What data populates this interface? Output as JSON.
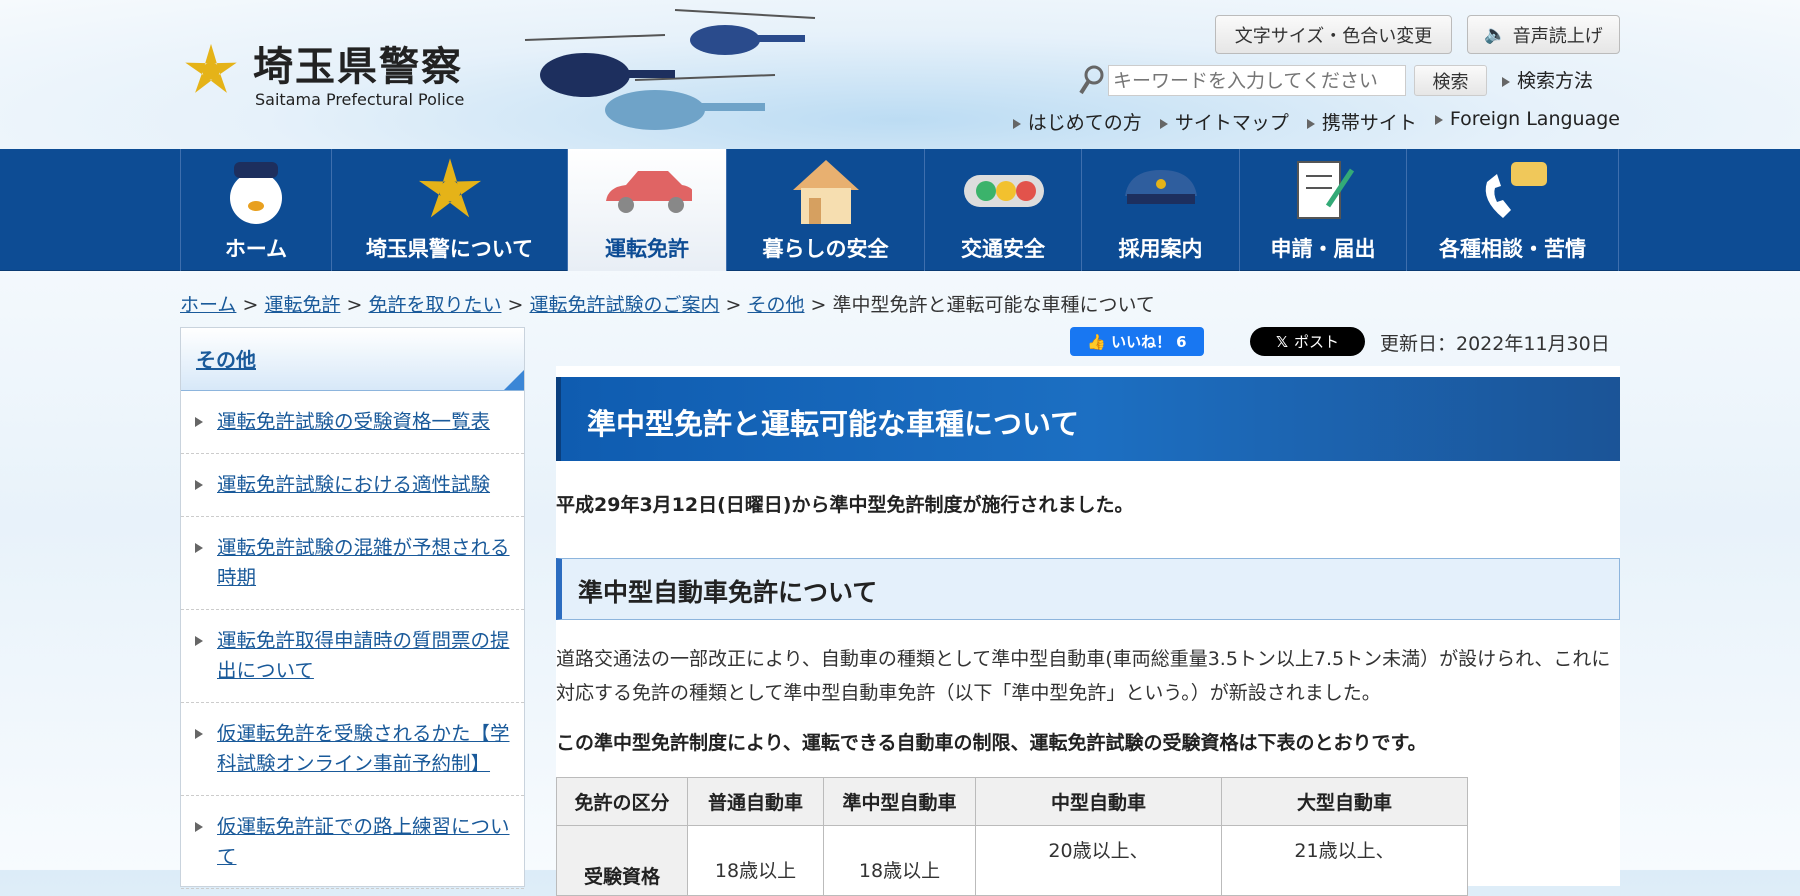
{
  "header": {
    "logo_ja": "埼玉県警察",
    "logo_en": "Saitama Prefectural Police",
    "text_size_button": "文字サイズ・色合い変更",
    "read_aloud_button": "音声読上げ",
    "search_placeholder": "キーワードを入力してください",
    "search_button": "検索",
    "search_help": "検索方法",
    "links": [
      "はじめての方",
      "サイトマップ",
      "携帯サイト",
      "Foreign Language"
    ]
  },
  "nav": [
    {
      "label": "ホーム",
      "icon": "mascot-icon"
    },
    {
      "label": "埼玉県警について",
      "icon": "police-emblem-icon"
    },
    {
      "label": "運転免許",
      "icon": "car-icon",
      "active": true
    },
    {
      "label": "暮らしの安全",
      "icon": "house-icon"
    },
    {
      "label": "交通安全",
      "icon": "traffic-light-icon"
    },
    {
      "label": "採用案内",
      "icon": "police-cap-icon"
    },
    {
      "label": "申請・届出",
      "icon": "form-pen-icon"
    },
    {
      "label": "各種相談・苦情",
      "icon": "phone-chat-icon"
    }
  ],
  "breadcrumb": [
    "ホーム",
    "運転免許",
    "免許を取りたい",
    "運転免許試験のご案内",
    "その他"
  ],
  "breadcrumb_current": "準中型免許と運転可能な車種について",
  "sidebar": {
    "title": "その他",
    "items": [
      "運転免許試験の受験資格一覧表",
      "運転免許試験における適性試験",
      "運転免許試験の混雑が予想される時期",
      "運転免許取得申請時の質問票の提出について",
      "仮運転免許を受験されるかた【学科試験オンライン事前予約制】",
      "仮運転免許証での路上練習について"
    ]
  },
  "social": {
    "like_label": "いいね！",
    "like_count": "6",
    "post_label": "ポスト"
  },
  "updated": "更新日：2022年11月30日",
  "main": {
    "title": "準中型免許と運転可能な車種について",
    "intro": "平成29年3月12日(日曜日)から準中型免許制度が施行されました。",
    "h3": "準中型自動車免許について",
    "para": "道路交通法の一部改正により、自動車の種類として準中型自動車(車両総重量3.5トン以上7.5トン未満）が設けられ、これに対応する免許の種類として準中型自動車免許（以下「準中型免許」という。）が新設されました。",
    "bold": "この準中型免許制度により、運転できる自動車の制限、運転免許試験の受験資格は下表のとおりです。",
    "table": {
      "headers": [
        "免許の区分",
        "普通自動車",
        "準中型自動車",
        "中型自動車",
        "大型自動車"
      ],
      "rows": [
        [
          "受験資格",
          "18歳以上",
          "18歳以上",
          "20歳以上、",
          "21歳以上、"
        ]
      ]
    }
  },
  "colors": {
    "nav": "#0d4c94",
    "link": "#1a5a9a",
    "like": "#1877f2"
  }
}
